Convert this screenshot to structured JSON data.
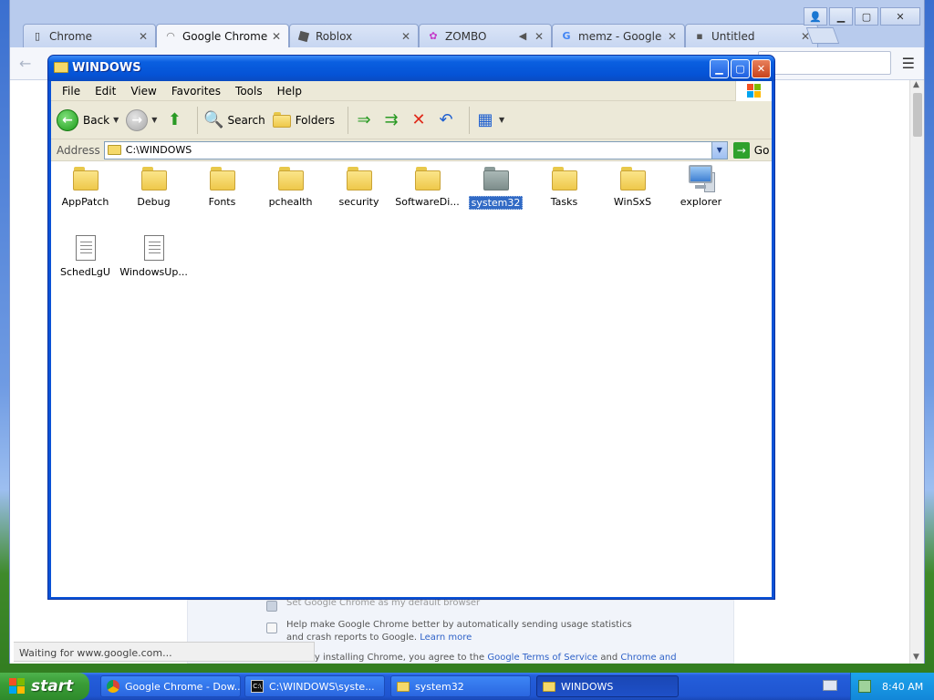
{
  "chrome": {
    "tabs": [
      {
        "title": "Chrome",
        "close": "✕"
      },
      {
        "title": "Google Chrome - D",
        "close": "✕"
      },
      {
        "title": "Roblox",
        "close": "✕"
      },
      {
        "title": "ZOMBO",
        "close": "✕"
      },
      {
        "title": "memz - Google Se",
        "close": "✕"
      },
      {
        "title": "Untitled",
        "close": "✕"
      }
    ],
    "page": {
      "option_top": "Set Google Chrome as my default browser",
      "option_stats": "Help make Google Chrome better by automatically sending usage statistics and crash reports to Google.",
      "learn_more": "Learn more",
      "terms_prefix": "By installing Chrome, you agree to the",
      "terms_link": "Google Terms of Service",
      "terms_and": "and",
      "terms_link2": "Chrome and"
    },
    "status": "Waiting for www.google.com..."
  },
  "explorer": {
    "title": "WINDOWS",
    "menu": [
      "File",
      "Edit",
      "View",
      "Favorites",
      "Tools",
      "Help"
    ],
    "toolbar": {
      "back": "Back",
      "search": "Search",
      "folders": "Folders"
    },
    "address": {
      "label": "Address",
      "value": "C:\\WINDOWS",
      "go": "Go"
    },
    "items": [
      {
        "label": "AppPatch",
        "type": "folder"
      },
      {
        "label": "Debug",
        "type": "folder"
      },
      {
        "label": "Fonts",
        "type": "folder"
      },
      {
        "label": "pchealth",
        "type": "folder"
      },
      {
        "label": "security",
        "type": "folder"
      },
      {
        "label": "SoftwareDi...",
        "type": "folder"
      },
      {
        "label": "system32",
        "type": "folder",
        "selected": true
      },
      {
        "label": "Tasks",
        "type": "folder"
      },
      {
        "label": "WinSxS",
        "type": "folder"
      },
      {
        "label": "explorer",
        "type": "exe"
      },
      {
        "label": "SchedLgU",
        "type": "doc"
      },
      {
        "label": "WindowsUp...",
        "type": "doc"
      }
    ]
  },
  "taskbar": {
    "start": "start",
    "tasks": [
      {
        "label": "Google Chrome - Dow..."
      },
      {
        "label": "C:\\WINDOWS\\syste..."
      },
      {
        "label": "system32"
      },
      {
        "label": "WINDOWS"
      }
    ],
    "clock": "8:40 AM"
  }
}
